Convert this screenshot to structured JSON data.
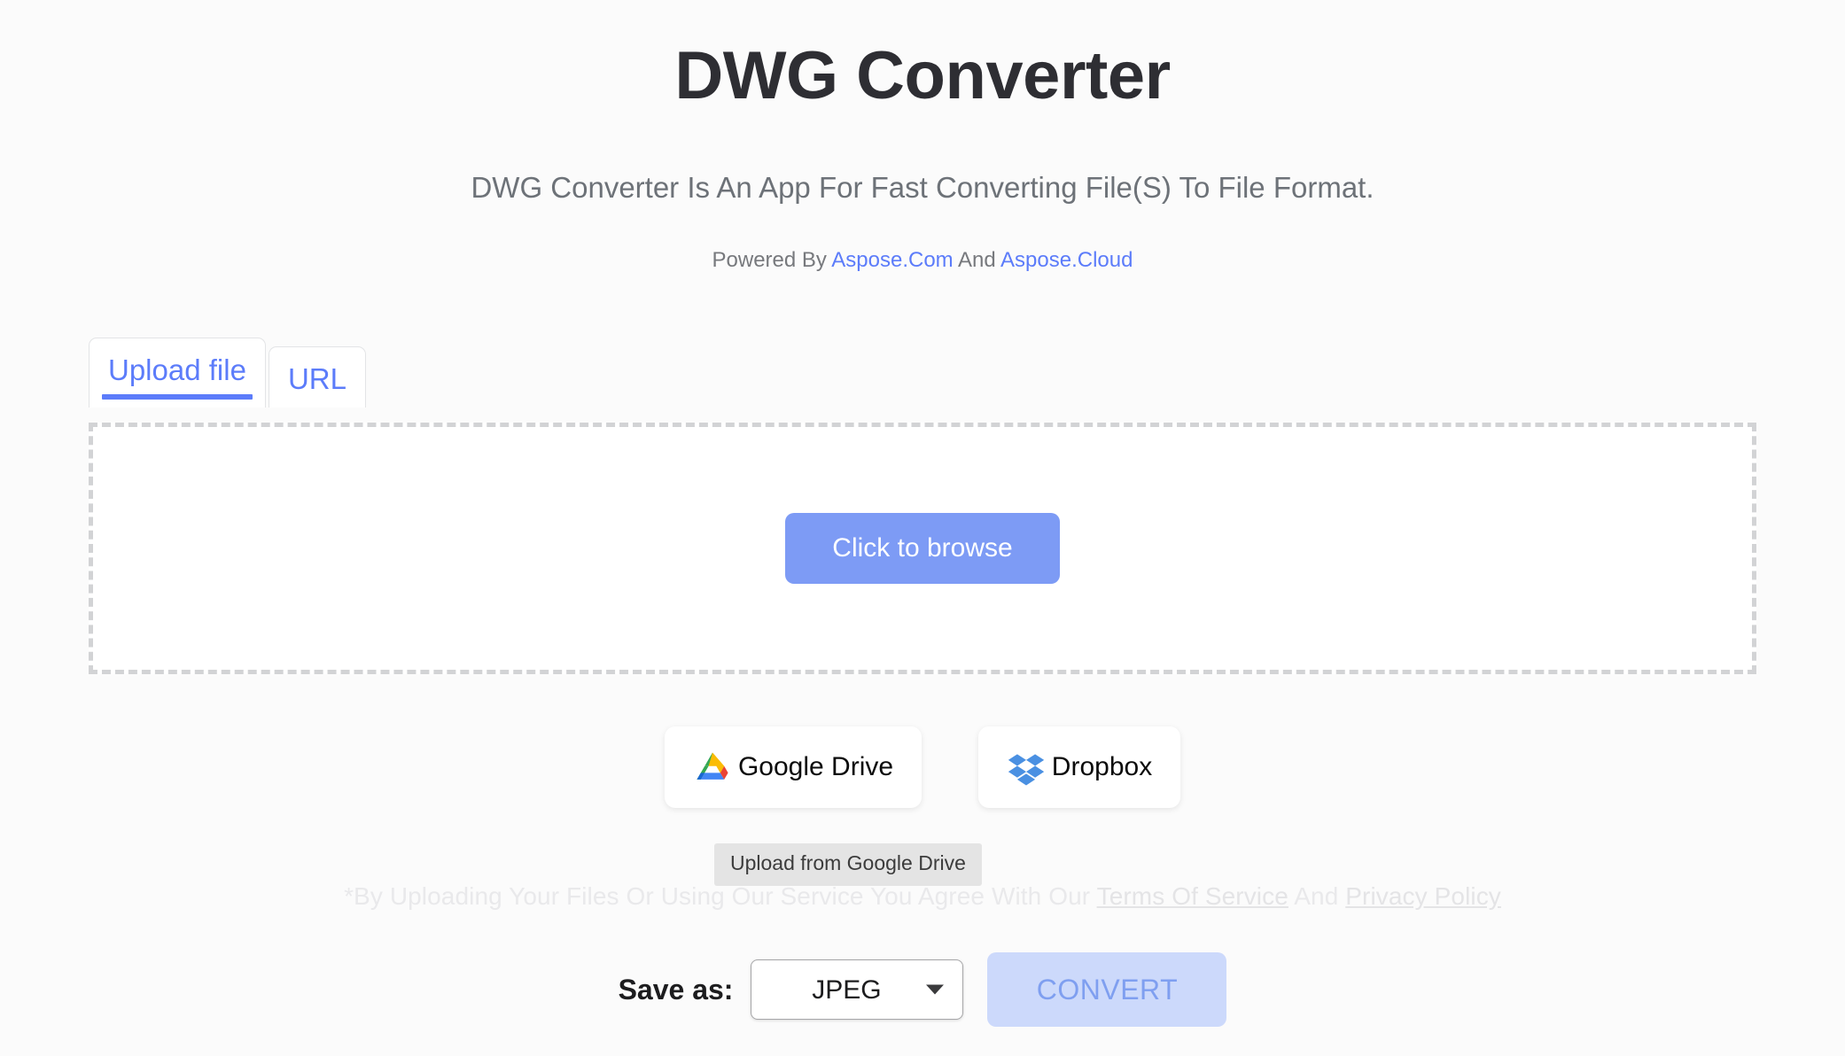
{
  "header": {
    "title": "DWG Converter",
    "subtitle": "DWG Converter Is An App For Fast Converting File(S) To File Format.",
    "powered_prefix": "Powered By ",
    "powered_link1": "Aspose.Com",
    "powered_middle": " And ",
    "powered_link2": "Aspose.Cloud"
  },
  "tabs": [
    {
      "label": "Upload file",
      "active": true
    },
    {
      "label": "URL",
      "active": false
    }
  ],
  "dropzone": {
    "browse_label": "Click to browse"
  },
  "cloud": [
    {
      "label": "Google Drive",
      "icon": "google-drive-icon"
    },
    {
      "label": "Dropbox",
      "icon": "dropbox-icon"
    }
  ],
  "tooltip": {
    "text": "Upload from Google Drive"
  },
  "terms": {
    "prefix": "*By Uploading Your Files Or Using Our Service You Agree With Our ",
    "link1": "Terms Of Service",
    "middle": " And ",
    "link2": "Privacy Policy"
  },
  "footer": {
    "saveas_label": "Save as:",
    "format_value": "JPEG",
    "format_options": [
      "JPEG"
    ],
    "convert_label": "CONVERT"
  },
  "colors": {
    "accent_blue": "#5c7cfa",
    "browse_button": "#7d9bf5",
    "convert_bg": "#ccd9fb",
    "convert_text": "#7f9ff0",
    "page_bg": "#fbfbfb",
    "title_text": "#2e2e33",
    "subtitle_text": "#6d7278",
    "dashed_border": "#d2d3d5",
    "tooltip_bg": "#e4e4e4",
    "terms_text": "#e9e9eb"
  }
}
